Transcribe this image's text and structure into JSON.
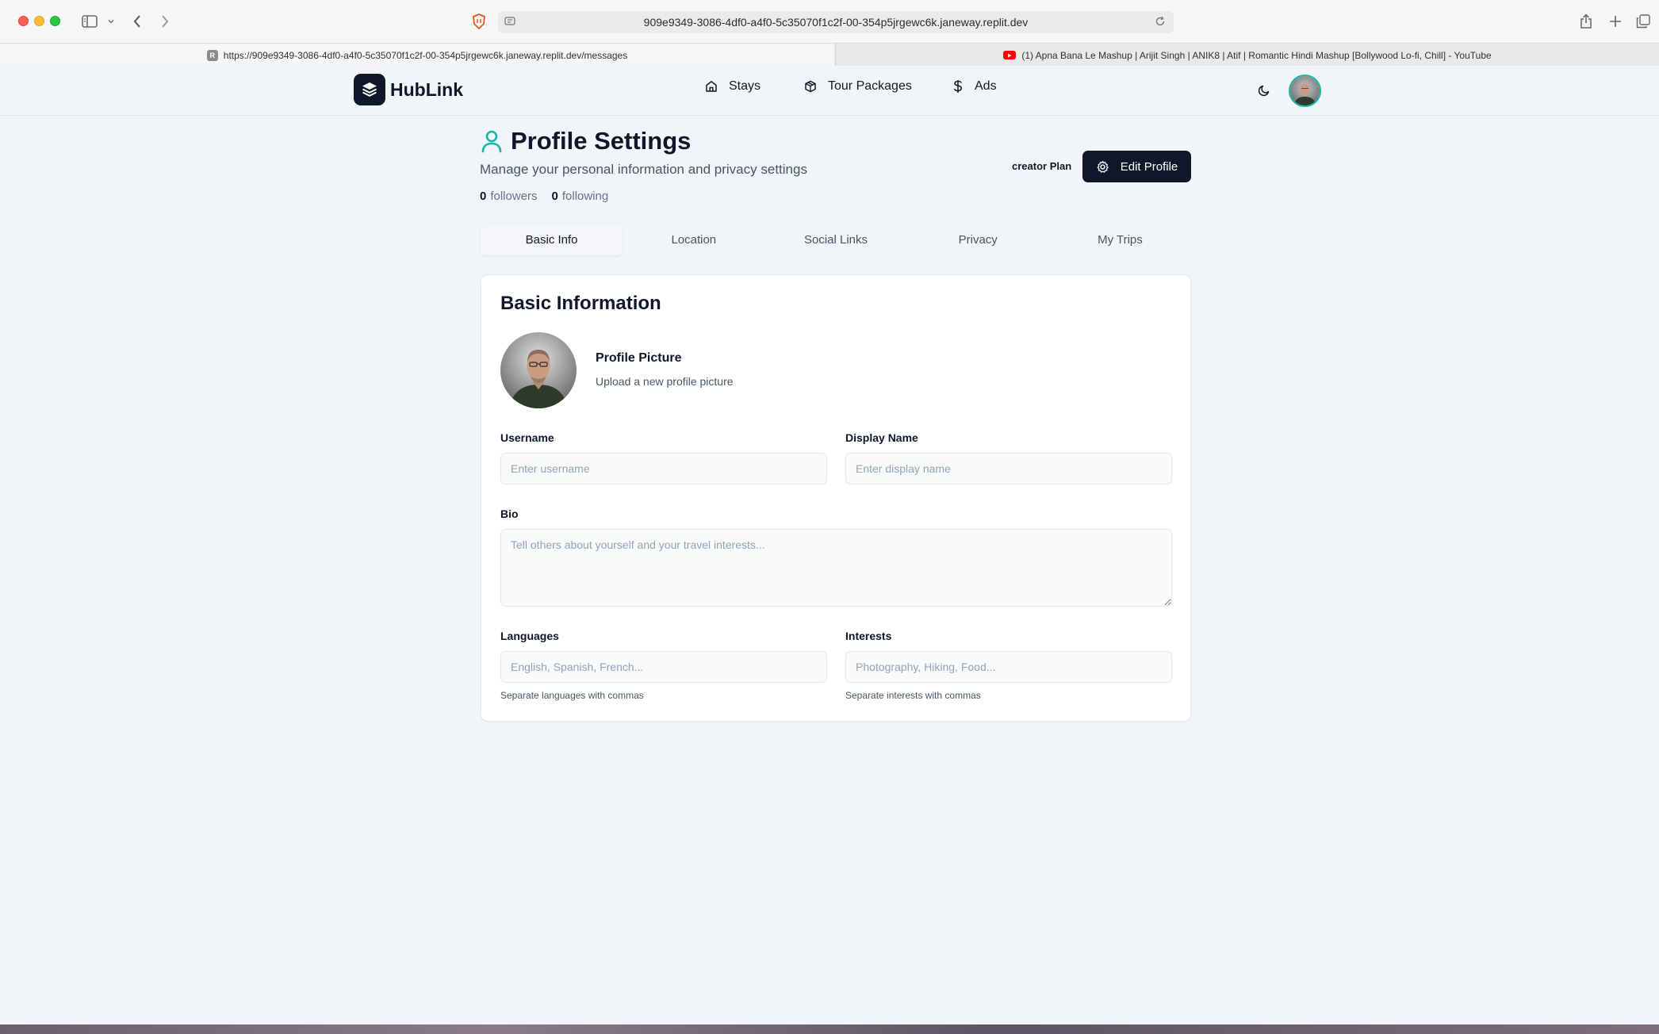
{
  "browser": {
    "address": "909e9349-3086-4df0-a4f0-5c35070f1c2f-00-354p5jrgewc6k.janeway.replit.dev",
    "tabs": [
      {
        "label": "https://909e9349-3086-4df0-a4f0-5c35070f1c2f-00-354p5jrgewc6k.janeway.replit.dev/messages",
        "favicon": "R"
      },
      {
        "label": "(1) Apna Bana Le Mashup | Arijit Singh | ANIK8 | Atif | Romantic Hindi Mashup [Bollywood Lo-fi, Chill] - YouTube",
        "favicon": "youtube-icon"
      }
    ]
  },
  "header": {
    "brand": "HubLink",
    "nav": [
      {
        "label": "Stays",
        "icon": "home-icon"
      },
      {
        "label": "Tour Packages",
        "icon": "package-icon"
      },
      {
        "label": "Ads",
        "icon": "dollar-icon"
      }
    ]
  },
  "page": {
    "title": "Profile Settings",
    "subtitle": "Manage your personal information and privacy settings",
    "followers_count": "0",
    "followers_label": "followers",
    "following_count": "0",
    "following_label": "following",
    "plan": "creator Plan",
    "edit_button": "Edit Profile"
  },
  "tabs": [
    "Basic Info",
    "Location",
    "Social Links",
    "Privacy",
    "My Trips"
  ],
  "form": {
    "title": "Basic Information",
    "picture_title": "Profile Picture",
    "picture_sub": "Upload a new profile picture",
    "username": {
      "label": "Username",
      "value": "",
      "placeholder": "Enter username"
    },
    "display_name": {
      "label": "Display Name",
      "value": "",
      "placeholder": "Enter display name"
    },
    "bio": {
      "label": "Bio",
      "value": "",
      "placeholder": "Tell others about yourself and your travel interests..."
    },
    "languages": {
      "label": "Languages",
      "value": "",
      "placeholder": "English, Spanish, French...",
      "hint": "Separate languages with commas"
    },
    "interests": {
      "label": "Interests",
      "value": "",
      "placeholder": "Photography, Hiking, Food...",
      "hint": "Separate interests with commas"
    }
  },
  "colors": {
    "brand_dark": "#0f172a",
    "accent_teal": "#14b8a6",
    "page_bg": "#f1f4f8"
  }
}
